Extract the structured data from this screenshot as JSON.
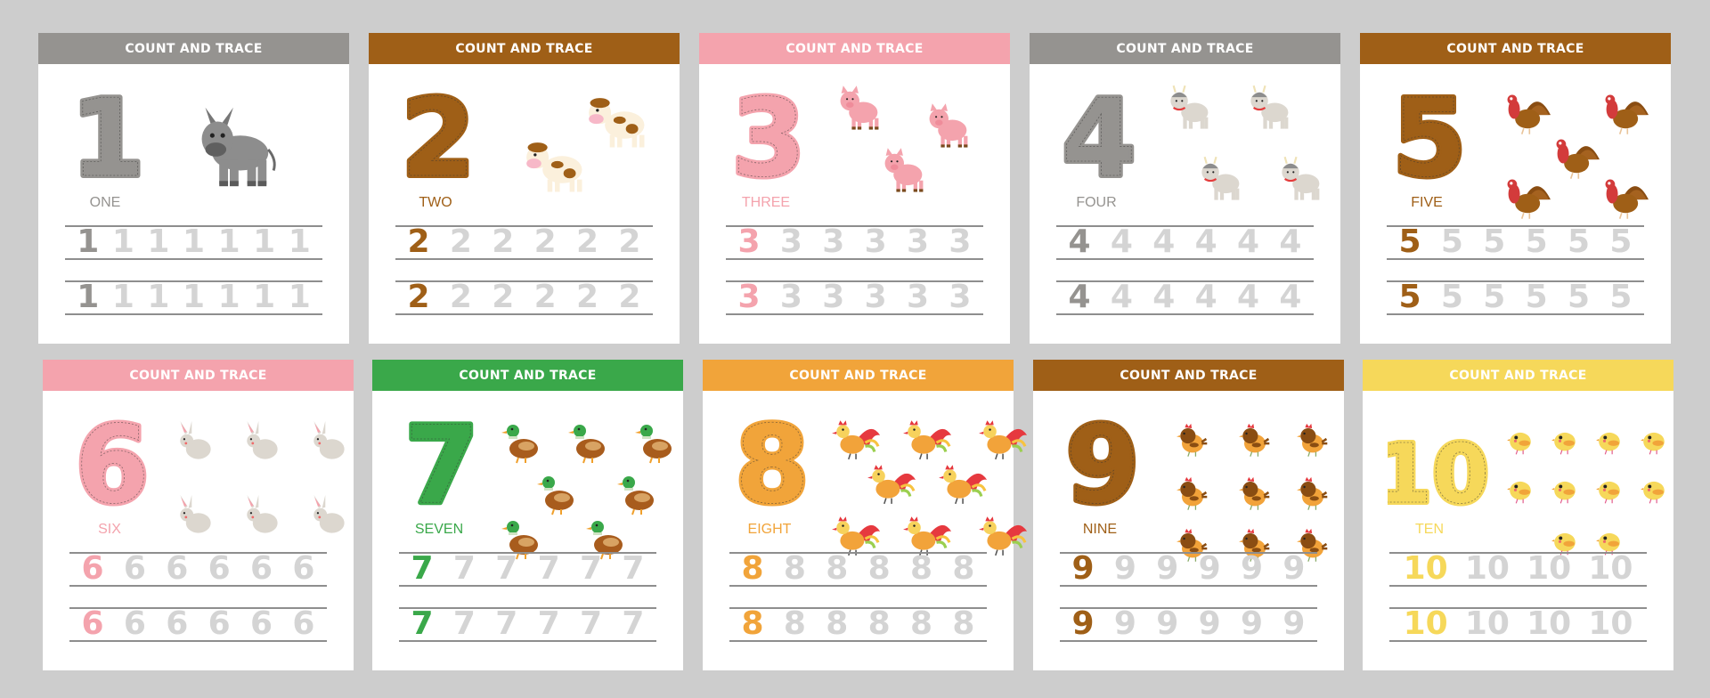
{
  "header_label": "COUNT AND TRACE",
  "trace_color": "#d4d4d4",
  "cards": [
    {
      "number": "1",
      "word": "ONE",
      "color": "#959390",
      "animal": "donkey",
      "count": 1,
      "trace_count": 7
    },
    {
      "number": "2",
      "word": "TWO",
      "color": "#9f5f17",
      "animal": "cow",
      "count": 2,
      "trace_count": 6
    },
    {
      "number": "3",
      "word": "THREE",
      "color": "#f4a3ad",
      "animal": "pig",
      "count": 3,
      "trace_count": 6
    },
    {
      "number": "4",
      "word": "FOUR",
      "color": "#959390",
      "animal": "goat",
      "count": 4,
      "trace_count": 6
    },
    {
      "number": "5",
      "word": "FIVE",
      "color": "#9f5f17",
      "animal": "turkey",
      "count": 5,
      "trace_count": 6
    },
    {
      "number": "6",
      "word": "SIX",
      "color": "#f4a3ad",
      "animal": "rabbit",
      "count": 6,
      "trace_count": 6
    },
    {
      "number": "7",
      "word": "SEVEN",
      "color": "#3aa84a",
      "animal": "duck",
      "count": 7,
      "trace_count": 6
    },
    {
      "number": "8",
      "word": "EIGHT",
      "color": "#f1a43a",
      "animal": "rooster",
      "count": 8,
      "trace_count": 6
    },
    {
      "number": "9",
      "word": "NINE",
      "color": "#9f5f17",
      "animal": "hen",
      "count": 9,
      "trace_count": 6
    },
    {
      "number": "10",
      "word": "TEN",
      "color": "#f6d85a",
      "animal": "chick",
      "count": 10,
      "trace_count": 4
    }
  ]
}
